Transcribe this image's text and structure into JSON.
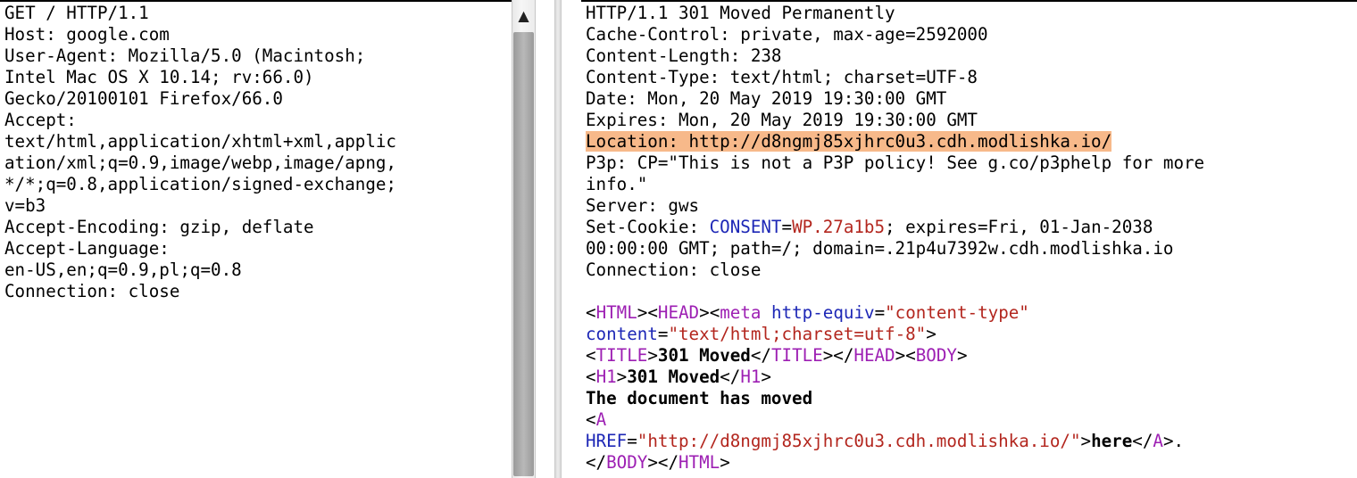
{
  "request": {
    "lines": [
      "GET / HTTP/1.1",
      "Host: google.com",
      "User-Agent: Mozilla/5.0 (Macintosh;",
      "Intel Mac OS X 10.14; rv:66.0)",
      "Gecko/20100101 Firefox/66.0",
      "Accept:",
      "text/html,application/xhtml+xml,applic",
      "ation/xml;q=0.9,image/webp,image/apng,",
      "*/*;q=0.8,application/signed-exchange;",
      "v=b3",
      "Accept-Encoding: gzip, deflate",
      "Accept-Language:",
      "en-US,en;q=0.9,pl;q=0.8",
      "Connection: close"
    ]
  },
  "scrollbar": {
    "up_arrow": "▲"
  },
  "response": {
    "status": "HTTP/1.1 301 Moved Permanently",
    "cache_control": "Cache-Control: private, max-age=2592000",
    "content_length": "Content-Length: 238",
    "content_type": "Content-Type: text/html; charset=UTF-8",
    "date": "Date: Mon, 20 May 2019 19:30:00 GMT",
    "expires": "Expires: Mon, 20 May 2019 19:30:00 GMT",
    "location": "Location: http://d8ngmj85xjhrc0u3.cdh.modlishka.io/",
    "p3p_1": "P3p: CP=\"This is not a P3P policy! See g.co/p3phelp for more",
    "p3p_2": "info.\"",
    "server": "Server: gws",
    "set_cookie_prefix": "Set-Cookie: ",
    "cookie_name": "CONSENT",
    "cookie_eq": "=",
    "cookie_value": "WP.27a1b5",
    "cookie_rest": "; expires=Fri, 01-Jan-2038",
    "cookie_line2": "00:00:00 GMT; path=/; domain=.21p4u7392w.cdh.modlishka.io",
    "connection": "Connection: close",
    "body": {
      "lt": "<",
      "gt": ">",
      "lt_slash": "</",
      "html_tag": "HTML",
      "head_tag": "HEAD",
      "meta_tag": "meta",
      "http_equiv_attr": "http-equiv",
      "eq": "=",
      "http_equiv_val": "\"content-type\"",
      "content_attr": "content",
      "content_val": "\"text/html;charset=utf-8\"",
      "title_tag": "TITLE",
      "title_text": "301 Moved",
      "body_tag": "BODY",
      "h1_tag": "H1",
      "h1_text": "301 Moved",
      "doc_moved": "The document has moved",
      "a_tag": "A",
      "href_attr": "HREF",
      "href_val": "\"http://d8ngmj85xjhrc0u3.cdh.modlishka.io/\"",
      "link_text": "here",
      "period": "."
    }
  }
}
